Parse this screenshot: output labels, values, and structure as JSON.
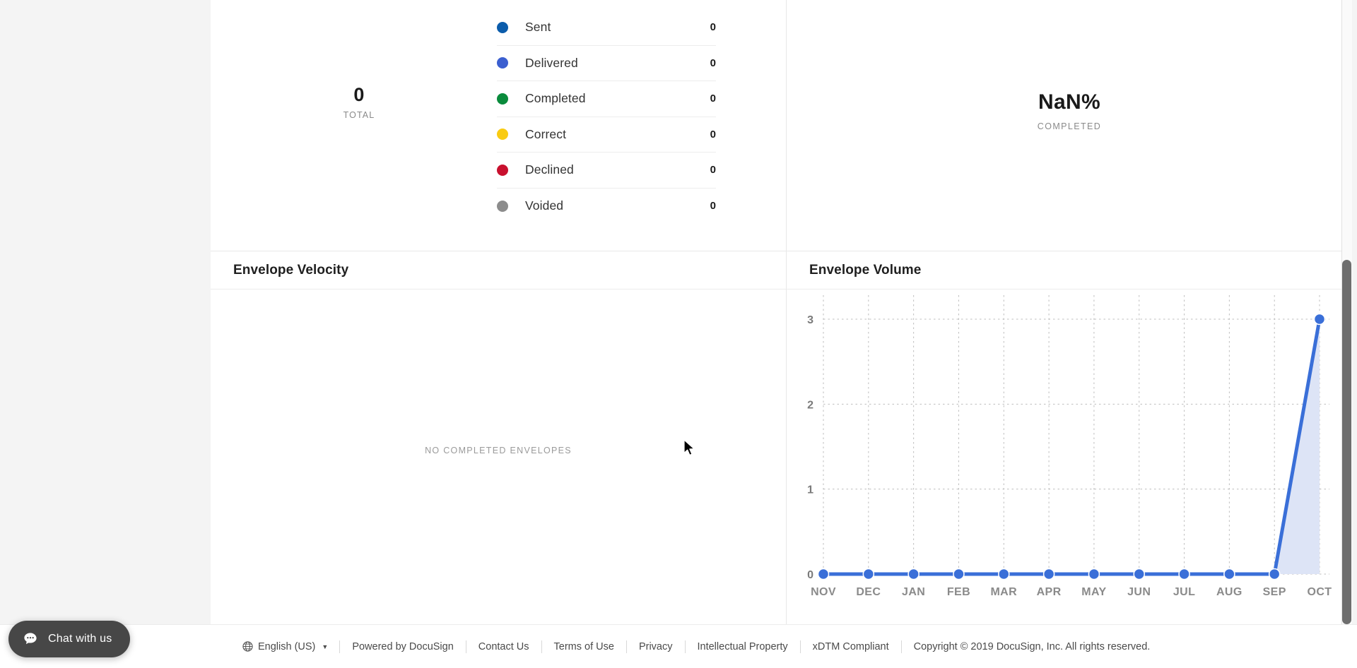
{
  "summary": {
    "total_value": "0",
    "total_label": "TOTAL",
    "completion_value": "NaN%",
    "completion_label": "COMPLETED",
    "legend": [
      {
        "label": "Sent",
        "value": "0",
        "color": "#0b5cab"
      },
      {
        "label": "Delivered",
        "value": "0",
        "color": "#3b5fd0"
      },
      {
        "label": "Completed",
        "value": "0",
        "color": "#0a8b3c"
      },
      {
        "label": "Correct",
        "value": "0",
        "color": "#f9cb12"
      },
      {
        "label": "Declined",
        "value": "0",
        "color": "#c8102e"
      },
      {
        "label": "Voided",
        "value": "0",
        "color": "#8c8c8c"
      }
    ]
  },
  "velocity_card": {
    "title": "Envelope Velocity",
    "empty_message": "NO COMPLETED ENVELOPES"
  },
  "volume_card": {
    "title": "Envelope Volume"
  },
  "chart_data": {
    "type": "area",
    "title": "Envelope Volume",
    "xlabel": "",
    "ylabel": "",
    "categories": [
      "NOV",
      "DEC",
      "JAN",
      "FEB",
      "MAR",
      "APR",
      "MAY",
      "JUN",
      "JUL",
      "AUG",
      "SEP",
      "OCT"
    ],
    "values": [
      0,
      0,
      0,
      0,
      0,
      0,
      0,
      0,
      0,
      0,
      0,
      3
    ],
    "ylim": [
      0,
      3
    ],
    "yticks": [
      "0",
      "1",
      "2",
      "3"
    ],
    "grid": true,
    "legend": "none",
    "line_color": "#3a6fd8",
    "fill_color": "#dde4f6",
    "marker_color": "#3a6fd8"
  },
  "footer": {
    "language": "English (US)",
    "links": [
      "Powered by DocuSign",
      "Contact Us",
      "Terms of Use",
      "Privacy",
      "Intellectual Property",
      "xDTM Compliant"
    ],
    "copyright": "Copyright © 2019 DocuSign, Inc. All rights reserved."
  },
  "chat": {
    "label": "Chat with us"
  }
}
